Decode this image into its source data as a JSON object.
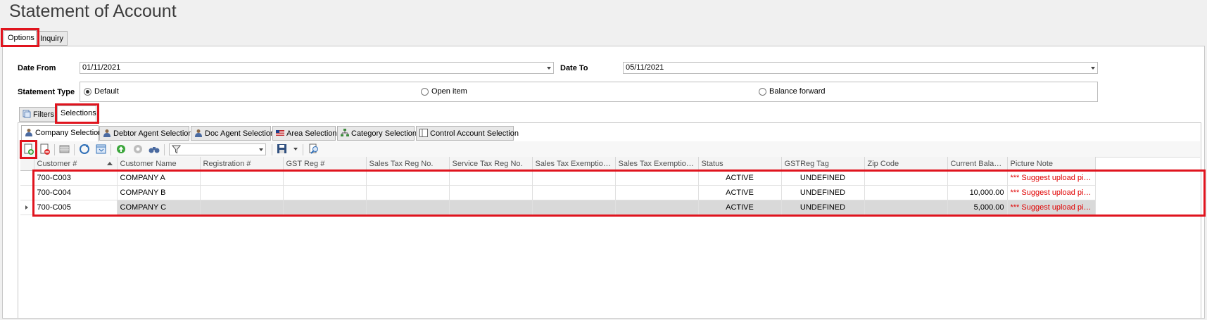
{
  "window": {
    "title": "Statement of Account"
  },
  "tabs": [
    {
      "label": "Options"
    },
    {
      "label": "Inquiry"
    }
  ],
  "options": {
    "date_from_label": "Date From",
    "date_from_value": "01/11/2021",
    "date_to_label": "Date To",
    "date_to_value": "05/11/2021",
    "statement_type_label": "Statement Type",
    "statement_types": [
      {
        "label": "Default",
        "checked": true
      },
      {
        "label": "Open item",
        "checked": false
      },
      {
        "label": "Balance forward",
        "checked": false
      }
    ]
  },
  "filter_tabs": [
    {
      "label": "Filters"
    },
    {
      "label": "Selections"
    }
  ],
  "selection_tabs": [
    {
      "label": "Company Selection"
    },
    {
      "label": "Debtor Agent Selection"
    },
    {
      "label": "Doc Agent Selection"
    },
    {
      "label": "Area Selection"
    },
    {
      "label": "Category Selection"
    },
    {
      "label": "Control Account Selection"
    }
  ],
  "grid": {
    "columns": [
      "Customer #",
      "Customer Name",
      "Registration #",
      "GST Reg #",
      "Sales Tax Reg No.",
      "Service Tax Reg No.",
      "Sales Tax Exemption No",
      "Sales Tax Exemption E...",
      "Status",
      "GSTReg Tag",
      "Zip Code",
      "Current Balance",
      "Picture Note"
    ],
    "rows": [
      {
        "customer": "700-C003",
        "name": "COMPANY A",
        "status": "ACTIVE",
        "gst_tag": "UNDEFINED",
        "balance": "",
        "note": "*** Suggest upload pictu..."
      },
      {
        "customer": "700-C004",
        "name": "COMPANY B",
        "status": "ACTIVE",
        "gst_tag": "UNDEFINED",
        "balance": "10,000.00",
        "note": "*** Suggest upload pictu..."
      },
      {
        "customer": "700-C005",
        "name": "COMPANY C",
        "status": "ACTIVE",
        "gst_tag": "UNDEFINED",
        "balance": "5,000.00",
        "note": "*** Suggest upload pictu..."
      }
    ]
  },
  "colors": {
    "highlight": "#e0141e",
    "note_text": "#e00000"
  }
}
